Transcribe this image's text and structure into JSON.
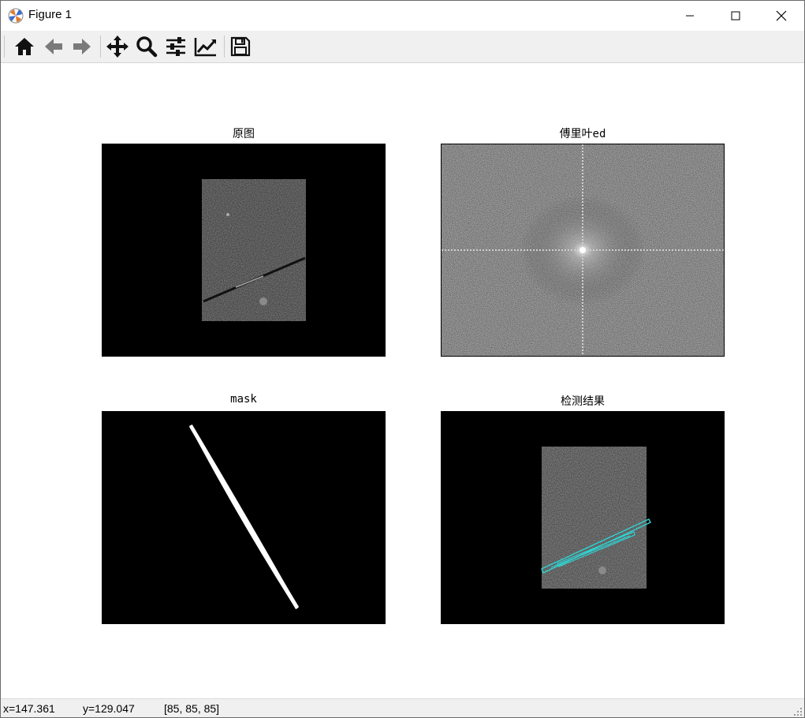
{
  "window": {
    "title": "Figure 1"
  },
  "toolbar": {
    "buttons": [
      {
        "name": "home-icon"
      },
      {
        "name": "back-arrow-icon"
      },
      {
        "name": "forward-arrow-icon"
      },
      {
        "name": "pan-icon"
      },
      {
        "name": "zoom-icon"
      },
      {
        "name": "configure-subplots-icon"
      },
      {
        "name": "edit-axis-icon"
      },
      {
        "name": "save-icon"
      }
    ]
  },
  "figure": {
    "subplots": [
      {
        "title": "原图",
        "content": "original grayscale image of a scratched surface on black background"
      },
      {
        "title": "傅里叶ed",
        "content": "Fourier magnitude spectrum"
      },
      {
        "title": "mask",
        "content": "white diagonal line on black"
      },
      {
        "title": "检测结果",
        "content": "image with cyan detected line outlines"
      }
    ],
    "accent_color": "#2fd4d4"
  },
  "status": {
    "x": "x=147.361",
    "y": "y=129.047",
    "pixel": "[85, 85, 85]"
  }
}
